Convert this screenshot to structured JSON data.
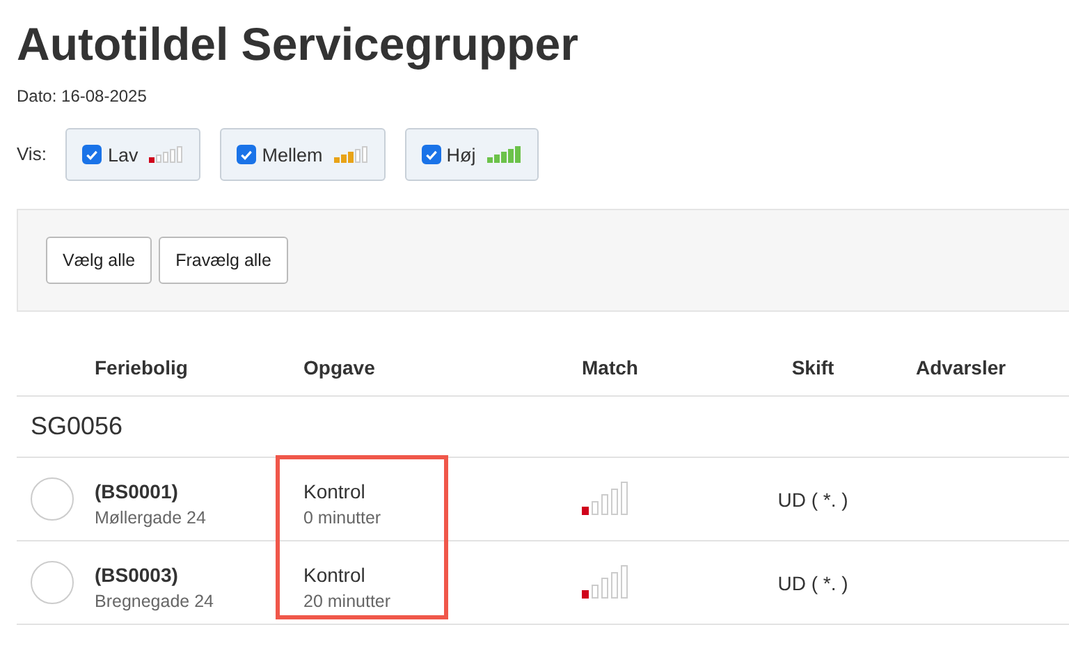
{
  "title": "Autotildel Servicegrupper",
  "date": "Dato: 16-08-2025",
  "filter": {
    "label": "Vis:",
    "options": [
      {
        "label": "Lav",
        "checked": true,
        "kind": "low"
      },
      {
        "label": "Mellem",
        "checked": true,
        "kind": "medium"
      },
      {
        "label": "Høj",
        "checked": true,
        "kind": "high"
      }
    ]
  },
  "toolbar": {
    "buttons": [
      "Vælg alle",
      "Fravælg alle"
    ]
  },
  "table": {
    "columns": [
      "Feriebolig",
      "Opgave",
      "Match",
      "Skift",
      "Advarsler"
    ],
    "highlight": {
      "color": "#f0574a"
    },
    "groups": [
      {
        "name": "SG0056",
        "rows": [
          {
            "selected": false,
            "id": "(BS0001)",
            "address": "Møllergade 24",
            "task": "Kontrol",
            "duration": "0 minutter",
            "match": {
              "kind": "low"
            },
            "shift": "UD ( *. )"
          },
          {
            "selected": false,
            "id": "(BS0003)",
            "address": "Bregnegade 24",
            "task": "Kontrol",
            "duration": "20 minutter",
            "match": {
              "kind": "low"
            },
            "shift": "UD ( *. )"
          }
        ]
      }
    ]
  }
}
